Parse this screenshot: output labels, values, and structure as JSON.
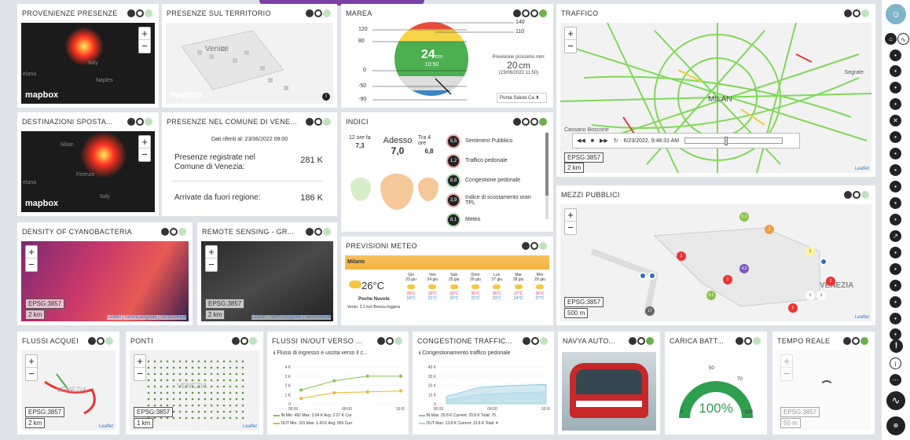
{
  "widgets": {
    "provenienze": {
      "title": "PROVENIENZE PRESENZE",
      "logo": "mapbox",
      "labels": [
        "Italy",
        "Naples",
        "elana"
      ]
    },
    "presenze_territorio": {
      "title": "PRESENZE SUL TERRITORIO",
      "logo": "mapbox",
      "labels": [
        "Venice"
      ]
    },
    "marea": {
      "title": "MAREA",
      "current_value": "24",
      "current_unit": "cm",
      "time": "10:50",
      "forecast_label": "Previsione prossimo min:",
      "forecast_value": "20",
      "forecast_unit": "cm",
      "forecast_date": "(23/06/2022 11:50)",
      "scale": [
        "120",
        "80",
        "0",
        "-50",
        "-90"
      ],
      "right_scale": [
        "140",
        "110"
      ],
      "station": "Punta Salute Ca"
    },
    "traffico": {
      "title": "TRAFFICO",
      "datetime": "6/23/2022, 9:48:31 AM",
      "epsg": "EPSG:3857",
      "scale": "2 km",
      "attribution": "Leaflet",
      "labels": [
        "MILAN",
        "Cassano Boscone",
        "Segrate"
      ]
    },
    "destinazioni": {
      "title": "DESTINAZIONI SPOSTA...",
      "logo": "mapbox",
      "labels": [
        "Milan",
        "Firenze",
        "Italy",
        "elana"
      ]
    },
    "presenze_comune": {
      "title": "PRESENZE NEL COMUNE DI VENE...",
      "date_line": "Dati riferiti al: 23/06/2022 09:00",
      "row1_label": "Presenze registrate nel Comune di Venezia:",
      "row1_value": "281 K",
      "row2_label": "Arrivate da fuori regione:",
      "row2_value": "186 K"
    },
    "indici": {
      "title": "INDICI",
      "left_time": "12 ore fa",
      "left_value": "7,3",
      "now_label": "Adesso",
      "now_value": "7,0",
      "right_time": "Tra 4 ore",
      "right_value": "6,8",
      "items": [
        {
          "score": "5,5",
          "label": "Sentiment Pubblico",
          "color": "#f2a5a5"
        },
        {
          "score": "1,2",
          "label": "Traffico pedonale",
          "color": "#f2a5a5"
        },
        {
          "score": "8,8",
          "label": "Congestione pedonale",
          "color": "#a8dca8"
        },
        {
          "score": "3,9",
          "label": "Indice di scostamento orari TPL",
          "color": "#f2a5a5"
        },
        {
          "score": "8,1",
          "label": "Meteo",
          "color": "#a8dca8"
        }
      ]
    },
    "cyano": {
      "title": "DENSITY OF CYANOBACTERIA",
      "epsg": "EPSG:3857",
      "scale": "2 km",
      "attribution": "Leaflet | fabbricadigitale | SentinelHub"
    },
    "remote": {
      "title": "REMOTE SENSING - GR...",
      "epsg": "EPSG:3857",
      "scale": "2 km",
      "attribution": "Leaflet | fabbricadigitale | SentinelHub"
    },
    "meteo": {
      "title": "PREVISIONI METEO",
      "city": "Milano",
      "temp": "26°C",
      "desc": "Poche Nuvole",
      "wind": "Vento: 2.1 m/s Brezza leggera",
      "days": [
        {
          "d": "Gio",
          "n": "23 giu",
          "t": "29°C",
          "l": "18°C"
        },
        {
          "d": "Ven",
          "n": "24 giu",
          "t": "32°C",
          "l": "21°C"
        },
        {
          "d": "Sab",
          "n": "25 giu",
          "t": "33°C",
          "l": "23°C"
        },
        {
          "d": "Dom",
          "n": "26 giu",
          "t": "35°C",
          "l": "22°C"
        },
        {
          "d": "Lun",
          "n": "27 giu",
          "t": "36°C",
          "l": "23°C"
        },
        {
          "d": "Mar",
          "n": "28 giu",
          "t": "37°C",
          "l": "24°C"
        },
        {
          "d": "Mer",
          "n": "29 giu",
          "t": "36°C",
          "l": "27°C"
        }
      ]
    },
    "mezzi": {
      "title": "MEZZI PUBBLICI",
      "epsg": "EPSG:3857",
      "scale": "500 m",
      "attribution": "Leaflet",
      "label": "VENEZIA",
      "badges": [
        "5.1",
        "3",
        "1",
        "2",
        "2",
        "4.2",
        "1",
        "17",
        "5.1",
        "2",
        "2",
        "1"
      ]
    },
    "flussi_acquei": {
      "title": "FLUSSI ACQUEI",
      "epsg": "EPSG:3857",
      "scale": "2 km",
      "attribution": "Leaflet",
      "label": "VENEZIA"
    },
    "ponti": {
      "title": "PONTI",
      "epsg": "EPSG:3857",
      "scale": "1 km",
      "attribution": "Leaflet",
      "label": "VENEZIA"
    },
    "flussi_inout": {
      "title": "FLUSSI IN/OUT VERSO ...",
      "subtitle": "Flussi di ingresso e uscita verso il c...",
      "legend_in": "IN Min: 492 Max: 3.04 K Avg: 2.27 K Cur",
      "legend_out": "OUT Min: 331 Max: 1.43 K Avg: 959 Curr"
    },
    "congestione": {
      "title": "CONGESTIONE TRAFFIC...",
      "subtitle": "Congestionamento traffico pedonale",
      "legend_in": "IN Max: 20.8 K Current: 20.8 K Total: 75.",
      "legend_out": "OUT Max: 13.8 K Current: 13.8 K Total: 4"
    },
    "navya": {
      "title": "NAVYA AUTO..."
    },
    "carica": {
      "title": "CARICA BATT...",
      "value": "100%",
      "ticks": [
        "0",
        "50",
        "70",
        "100"
      ]
    },
    "tempo_reale": {
      "title": "TEMPO REALE",
      "epsg": "EPSG:3857",
      "scale": "50 m"
    }
  },
  "chart_data": [
    {
      "type": "line",
      "title": "",
      "subtitle": "Flussi di ingresso e uscita verso il c...",
      "categories": [
        "06:00",
        "08:00",
        "10:00"
      ],
      "yticks": [
        "4 K",
        "3 K",
        "2 K",
        "1 K",
        "0"
      ],
      "series": [
        {
          "name": "IN",
          "values": [
            1.5,
            2.5,
            3.0,
            3.0
          ],
          "color": "#8bc34a"
        },
        {
          "name": "OUT",
          "values": [
            0.6,
            1.2,
            1.3,
            1.4
          ],
          "color": "#f0b429"
        }
      ]
    },
    {
      "type": "area",
      "title": "",
      "subtitle": "Congestionamento traffico pedonale",
      "categories": [
        "06:00",
        "08:00",
        "10:00"
      ],
      "yticks": [
        "40 K",
        "30 K",
        "20 K",
        "10 K",
        "0"
      ],
      "series": [
        {
          "name": "IN",
          "values": [
            8,
            18,
            20,
            21
          ],
          "color": "#7ec0d6"
        },
        {
          "name": "OUT",
          "values": [
            4,
            10,
            12,
            13
          ],
          "color": "#a5d6e6"
        }
      ]
    }
  ],
  "timer": {
    "play": "▶",
    "pause": "❚❚"
  }
}
